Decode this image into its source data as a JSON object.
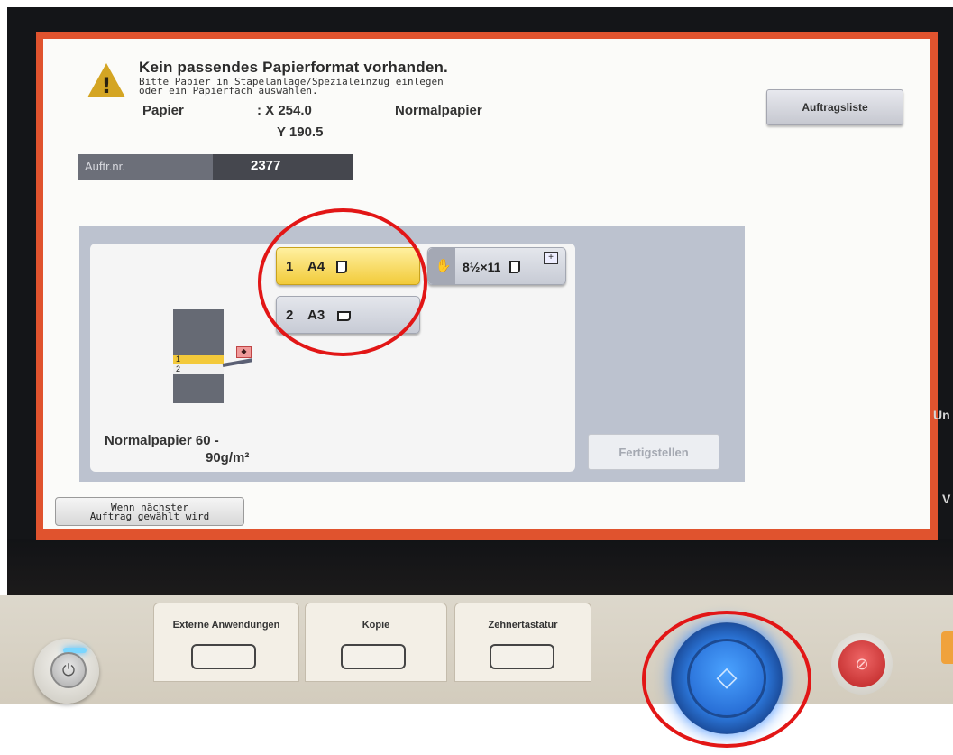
{
  "message": {
    "title": "Kein passendes Papierformat vorhanden.",
    "line1": "Bitte Papier in Stapelanlage/Spezialeinzug einlegen",
    "line2": "oder ein Papierfach auswählen."
  },
  "paper": {
    "label": "Papier",
    "x": ": X 254.0",
    "y": "Y 190.5",
    "type": "Normalpapier"
  },
  "job_list_button": "Auftragsliste",
  "job": {
    "label": "Auftr.nr.",
    "number": "2377"
  },
  "trays": [
    {
      "num": "1",
      "size": "A4",
      "selected": true
    },
    {
      "num": "2",
      "size": "A3",
      "selected": false
    }
  ],
  "bypass": {
    "size": "8½×11"
  },
  "diagram": {
    "tray1": "1",
    "tray2": "2"
  },
  "paper_type_line1": "Normalpapier 60 -",
  "paper_type_line2": "90g/m²",
  "finish_button": "Fertigstellen",
  "next_job_button": {
    "line1": "Wenn nächster",
    "line2": "Auftrag gewählt wird"
  },
  "edge_labels": [
    "Un",
    "V"
  ],
  "hardware": {
    "external_apps": "Externe Anwendungen",
    "copy": "Kopie",
    "keypad": "Zehnertastatur"
  },
  "icons": {
    "warning": "warning-triangle-icon",
    "start": "start-diamond-icon",
    "stop": "stop-icon",
    "power": "power-icon",
    "hand": "manual-feed-hand-icon"
  },
  "colors": {
    "frame": "#e0532e",
    "selected": "#f2cb3a",
    "start": "#2f7fe6",
    "annotation": "#e21616"
  }
}
